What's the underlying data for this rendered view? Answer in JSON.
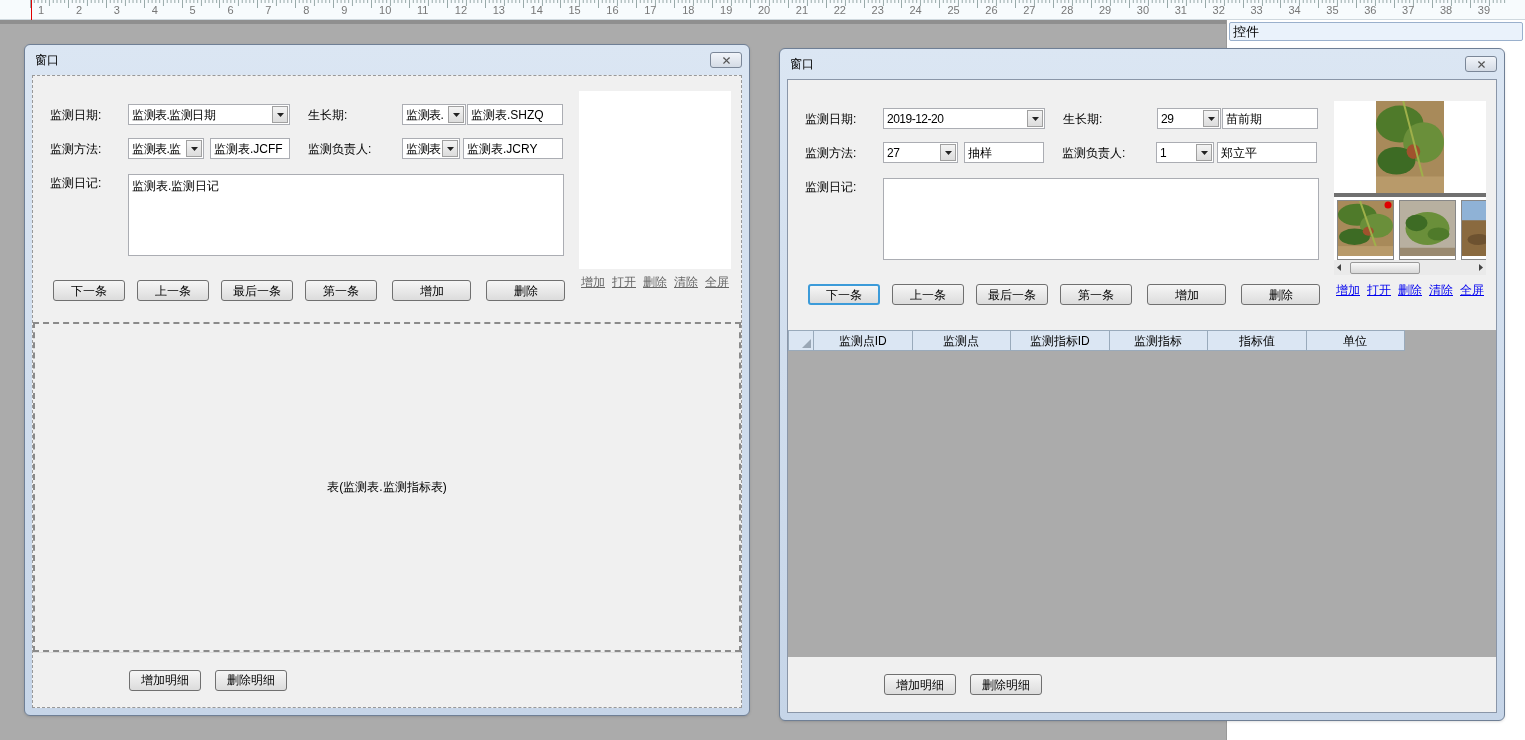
{
  "ruler": {
    "labels": [
      "1",
      "2",
      "3",
      "4",
      "5",
      "6",
      "7",
      "8",
      "9",
      "10",
      "11",
      "12",
      "13",
      "14",
      "15",
      "16",
      "17",
      "18",
      "19",
      "20",
      "21",
      "22",
      "23",
      "24",
      "25",
      "26",
      "27",
      "28",
      "29",
      "30",
      "31",
      "32",
      "33",
      "34",
      "35",
      "36",
      "37",
      "38",
      "39"
    ]
  },
  "side_panel": {
    "title": "控件"
  },
  "windows": [
    {
      "kind": "design",
      "title": "窗口",
      "date": {
        "label": "监测日期:",
        "value": "监测表.监测日期"
      },
      "growth": {
        "label": "生长期:",
        "code": "监测表.",
        "name": "监测表.SHZQ"
      },
      "method": {
        "label": "监测方法:",
        "code": "监测表.监",
        "name": "监测表.JCFF"
      },
      "person": {
        "label": "监测负责人:",
        "code": "监测表",
        "name": "监测表.JCRY"
      },
      "diary": {
        "label": "监测日记:",
        "value": "监测表.监测日记"
      },
      "buttons": [
        {
          "label": "下一条",
          "focused": false
        },
        {
          "label": "上一条",
          "focused": false
        },
        {
          "label": "最后一条",
          "focused": false
        },
        {
          "label": "第一条",
          "focused": false
        },
        {
          "label": "增加",
          "focused": false
        },
        {
          "label": "删除",
          "focused": false
        }
      ],
      "image_links": [
        "增加",
        "打开",
        "删除",
        "清除",
        "全屏"
      ],
      "detail": {
        "kind": "placeholder",
        "text": "表(监测表.监测指标表)"
      },
      "detail_buttons": [
        "增加明细",
        "删除明细"
      ]
    },
    {
      "kind": "runtime",
      "title": "窗口",
      "date": {
        "label": "监测日期:",
        "value": "2019-12-20"
      },
      "growth": {
        "label": "生长期:",
        "code": "29",
        "name": "苗前期"
      },
      "method": {
        "label": "监测方法:",
        "code": "27",
        "name": "抽样"
      },
      "person": {
        "label": "监测负责人:",
        "code": "1",
        "name": "郑立平"
      },
      "diary": {
        "label": "监测日记:"
      },
      "buttons": [
        {
          "label": "下一条",
          "focused": true
        },
        {
          "label": "上一条",
          "focused": false
        },
        {
          "label": "最后一条",
          "focused": false
        },
        {
          "label": "第一条",
          "focused": false
        },
        {
          "label": "增加",
          "focused": false
        },
        {
          "label": "删除",
          "focused": false
        }
      ],
      "image_links": [
        "增加",
        "打开",
        "删除",
        "清除",
        "全屏"
      ],
      "detail": {
        "kind": "grid",
        "columns": [
          "监测点ID",
          "监测点",
          "监测指标ID",
          "监测指标",
          "指标值",
          "单位"
        ]
      },
      "detail_buttons": [
        "增加明细",
        "删除明细"
      ]
    }
  ]
}
